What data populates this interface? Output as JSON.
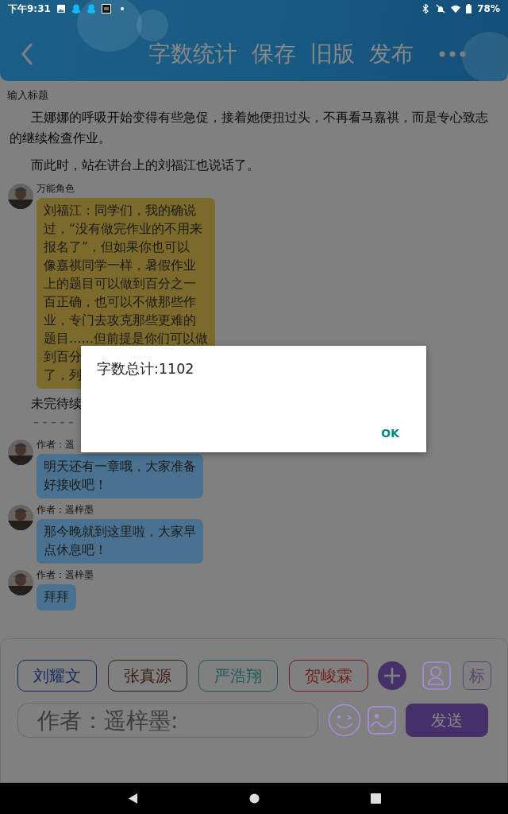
{
  "status_bar": {
    "time": "下午9:31",
    "battery": "78%"
  },
  "header": {
    "actions": [
      "字数统计",
      "保存",
      "旧版",
      "发布"
    ]
  },
  "title_field": {
    "placeholder": "输入标题"
  },
  "story": [
    {
      "kind": "paragraph",
      "text": "王娜娜的呼吸开始变得有些急促，接着她便扭过头，不再看马嘉祺，而是专心致志的继续检查作业。"
    },
    {
      "kind": "paragraph",
      "text": "而此时，站在讲台上的刘福江也说话了。"
    },
    {
      "kind": "message",
      "author": "万能角色",
      "color": "#7c6a2c",
      "lines": [
        "刘福江：同学们，我的确说",
        "过，“没有做完作业的不用来",
        "报名了”，但如果你也可以",
        "像嘉祺同学一样，暑假作业",
        "上的题目可以做到百分之一",
        "百正确，也可以不做那些作",
        "业，专门去攻克那些更难的",
        "题目……但前提是你们可以做",
        "到百分",
        "了，列"
      ]
    },
    {
      "kind": "paragraph",
      "text": "未完待续"
    },
    {
      "kind": "divider",
      "text": "－－－－－"
    },
    {
      "kind": "message",
      "author": "作者：遥",
      "color": "#4a7290",
      "lines": [
        "明天还有一章哦，大家准备",
        "好接收吧！"
      ]
    },
    {
      "kind": "message",
      "author": "作者：遥梓墨",
      "color": "#4a7290",
      "lines": [
        "那今晚就到这里啦，大家早",
        "点休息吧！"
      ]
    },
    {
      "kind": "message",
      "author": "作者：遥梓墨",
      "color": "#4a7290",
      "lines": [
        "拜拜"
      ]
    }
  ],
  "composer": {
    "characters": [
      {
        "name": "刘耀文",
        "color": "#152b63"
      },
      {
        "name": "张真源",
        "color": "#3d2018"
      },
      {
        "name": "严浩翔",
        "color": "#205a58"
      },
      {
        "name": "贺峻霖",
        "color": "#711d1d"
      }
    ],
    "tag_button": "标",
    "input": {
      "placeholder": "作者：遥梓墨:"
    },
    "send_button": "发送"
  },
  "dialog": {
    "message": "字数总计:1102",
    "button": "OK"
  }
}
